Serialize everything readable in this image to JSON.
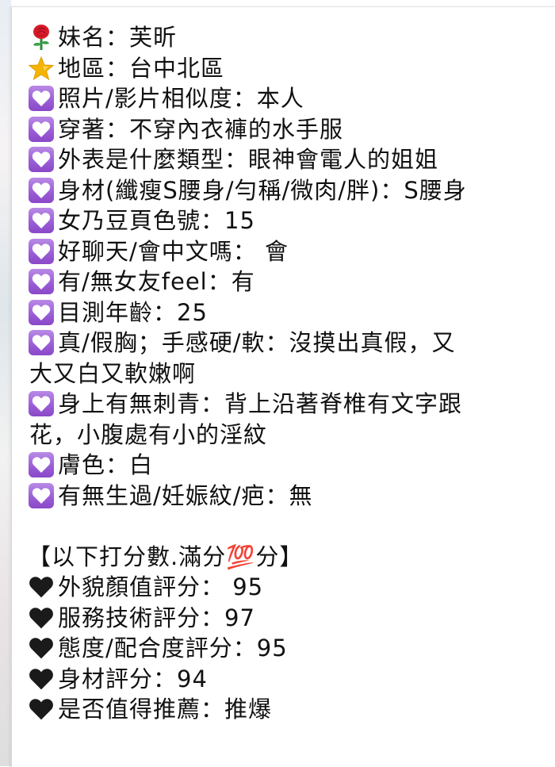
{
  "lines": [
    {
      "icon": "rose-icon",
      "text": "妹名：芙昕"
    },
    {
      "icon": "star-icon",
      "text": "地區：台中北區"
    },
    {
      "icon": "purple-heart-icon",
      "text": "照片/影片相似度：本人"
    },
    {
      "icon": "purple-heart-icon",
      "text": "穿著：不穿內衣褲的水手服"
    },
    {
      "icon": "purple-heart-icon",
      "text": "外表是什麼類型：眼神會電人的姐姐"
    },
    {
      "icon": "purple-heart-icon",
      "text": "身材(纖瘦S腰身/勻稱/微肉/胖)：S腰身"
    },
    {
      "icon": "purple-heart-icon",
      "text": "女乃豆頁色號：15"
    },
    {
      "icon": "purple-heart-icon",
      "text": "好聊天/會中文嗎： 會"
    },
    {
      "icon": "purple-heart-icon",
      "text": "有/無女友feel：有"
    },
    {
      "icon": "purple-heart-icon",
      "text": "目測年齡：25"
    },
    {
      "icon": "purple-heart-icon",
      "text": "真/假胸；手感硬/軟：沒摸出真假，又"
    },
    {
      "icon": "",
      "text": "大又白又軟嫩啊"
    },
    {
      "icon": "purple-heart-icon",
      "text": "身上有無刺青：背上沿著脊椎有文字跟"
    },
    {
      "icon": "",
      "text": "花，小腹處有小的淫紋"
    },
    {
      "icon": "purple-heart-icon",
      "text": "膚色：白"
    },
    {
      "icon": "purple-heart-icon",
      "text": "有無生過/妊娠紋/疤：無"
    },
    {
      "icon": "",
      "text": ""
    },
    {
      "icon": "",
      "text": "【以下打分數.滿分💯分】"
    },
    {
      "icon": "black-heart-icon",
      "text": "外貌顏值評分： 95"
    },
    {
      "icon": "black-heart-icon",
      "text": "服務技術評分：97"
    },
    {
      "icon": "black-heart-icon",
      "text": "態度/配合度評分：95"
    },
    {
      "icon": "black-heart-icon",
      "text": "身材評分：94"
    },
    {
      "icon": "black-heart-icon",
      "text": "是否值得推薦：推爆"
    }
  ],
  "colors": {
    "text": "#111111",
    "purple_heart_bg": "#9b5fd6",
    "rose_red": "#d81b2a",
    "star_gold": "#f5b400"
  }
}
